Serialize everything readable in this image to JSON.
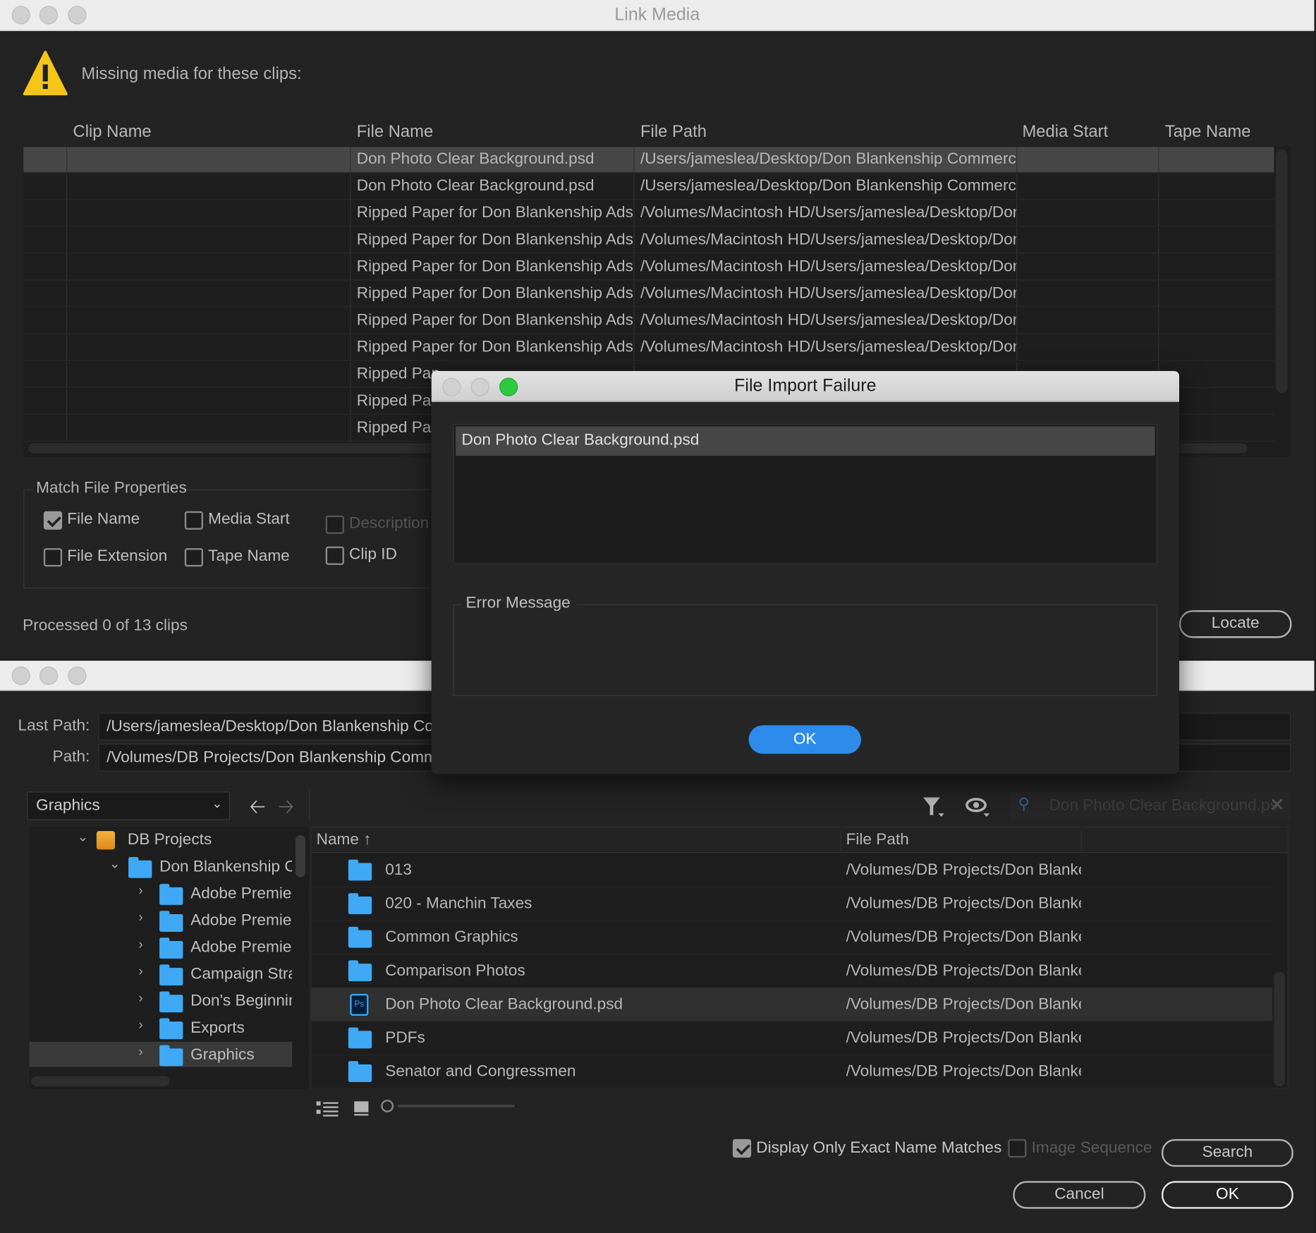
{
  "link_media": {
    "title": "Link Media",
    "warning": "Missing media for these clips:",
    "columns": [
      "Clip Name",
      "File Name",
      "File Path",
      "Media Start",
      "Tape Name"
    ],
    "rows": [
      {
        "clip": "",
        "file": "Don Photo Clear Background.psd",
        "path": "/Users/jameslea/Desktop/Don Blankenship Commercia",
        "start": "",
        "tape": ""
      },
      {
        "clip": "",
        "file": "Don Photo Clear Background.psd",
        "path": "/Users/jameslea/Desktop/Don Blankenship Commercia",
        "start": "",
        "tape": ""
      },
      {
        "clip": "",
        "file": "Ripped Paper for Don Blankenship Ads.p",
        "path": "/Volumes/Macintosh HD/Users/jameslea/Desktop/Don",
        "start": "",
        "tape": ""
      },
      {
        "clip": "",
        "file": "Ripped Paper for Don Blankenship Ads.p",
        "path": "/Volumes/Macintosh HD/Users/jameslea/Desktop/Don",
        "start": "",
        "tape": ""
      },
      {
        "clip": "",
        "file": "Ripped Paper for Don Blankenship Ads.p",
        "path": "/Volumes/Macintosh HD/Users/jameslea/Desktop/Don",
        "start": "",
        "tape": ""
      },
      {
        "clip": "",
        "file": "Ripped Paper for Don Blankenship Ads.p",
        "path": "/Volumes/Macintosh HD/Users/jameslea/Desktop/Don",
        "start": "",
        "tape": ""
      },
      {
        "clip": "",
        "file": "Ripped Paper for Don Blankenship Ads.p",
        "path": "/Volumes/Macintosh HD/Users/jameslea/Desktop/Don",
        "start": "",
        "tape": ""
      },
      {
        "clip": "",
        "file": "Ripped Paper for Don Blankenship Ads.p",
        "path": "/Volumes/Macintosh HD/Users/jameslea/Desktop/Don",
        "start": "",
        "tape": ""
      },
      {
        "clip": "",
        "file": "Ripped Pap",
        "path": "",
        "start": "",
        "tape": ""
      },
      {
        "clip": "",
        "file": "Ripped Pap",
        "path": "",
        "start": "",
        "tape": ""
      },
      {
        "clip": "",
        "file": "Ripped Pap",
        "path": "",
        "start": "",
        "tape": ""
      }
    ],
    "match_group": "Match File Properties",
    "match_options": [
      {
        "label": "File Name",
        "checked": true
      },
      {
        "label": "Media Start",
        "checked": false
      },
      {
        "label": "Description",
        "checked": false,
        "disabled": true
      },
      {
        "label": "File Extension",
        "checked": false
      },
      {
        "label": "Tape Name",
        "checked": false
      },
      {
        "label": "Clip ID",
        "checked": false
      }
    ],
    "status": "Processed 0 of 13 clips",
    "locate_label": "Locate"
  },
  "locate_dialog": {
    "last_path_label": "Last Path:",
    "last_path": "/Users/jameslea/Desktop/Don Blankenship Con",
    "path_label": "Path:",
    "path": "/Volumes/DB Projects/Don Blankenship Comme",
    "location_select": "Graphics",
    "search_placeholder": "Don Photo Clear Background.ps",
    "tree": [
      {
        "label": "DB Projects",
        "level": 0,
        "type": "drive",
        "expanded": true
      },
      {
        "label": "Don Blankenship Co",
        "level": 1,
        "type": "folder",
        "expanded": true
      },
      {
        "label": "Adobe Premier",
        "level": 2,
        "type": "folder"
      },
      {
        "label": "Adobe Premier",
        "level": 2,
        "type": "folder"
      },
      {
        "label": "Adobe Premier",
        "level": 2,
        "type": "folder"
      },
      {
        "label": "Campaign Strat",
        "level": 2,
        "type": "folder"
      },
      {
        "label": "Don's Beginnin",
        "level": 2,
        "type": "folder"
      },
      {
        "label": "Exports",
        "level": 2,
        "type": "folder"
      },
      {
        "label": "Graphics",
        "level": 2,
        "type": "folder",
        "selected": true
      }
    ],
    "columns": {
      "name": "Name",
      "sort": "↑",
      "path": "File Path"
    },
    "files": [
      {
        "name": "013",
        "path": "/Volumes/DB Projects/Don Blanke",
        "type": "folder"
      },
      {
        "name": "020 - Manchin Taxes",
        "path": "/Volumes/DB Projects/Don Blanke",
        "type": "folder"
      },
      {
        "name": "Common Graphics",
        "path": "/Volumes/DB Projects/Don Blanke",
        "type": "folder"
      },
      {
        "name": "Comparison Photos",
        "path": "/Volumes/DB Projects/Don Blanke",
        "type": "folder"
      },
      {
        "name": "Don Photo Clear Background.psd",
        "path": "/Volumes/DB Projects/Don Blanke",
        "type": "psd",
        "selected": true
      },
      {
        "name": "PDFs",
        "path": "/Volumes/DB Projects/Don Blanke",
        "type": "folder"
      },
      {
        "name": "Senator and Congressmen",
        "path": "/Volumes/DB Projects/Don Blanke",
        "type": "folder"
      }
    ],
    "psd_badge": "Ps",
    "exact_match_label": "Display Only Exact Name Matches",
    "exact_match_checked": true,
    "image_sequence_label": "Image Sequence",
    "image_sequence_checked": false,
    "search_label": "Search",
    "cancel_label": "Cancel",
    "ok_label": "OK"
  },
  "failure_dialog": {
    "title": "File Import Failure",
    "files": [
      "Don Photo Clear Background.psd"
    ],
    "error_group": "Error Message",
    "error_text": "",
    "ok_label": "OK"
  },
  "colors": {
    "accent": "#2d8ceb",
    "folder": "#3fa9f5",
    "warning": "#f5c518",
    "green_light": "#2ec940"
  }
}
